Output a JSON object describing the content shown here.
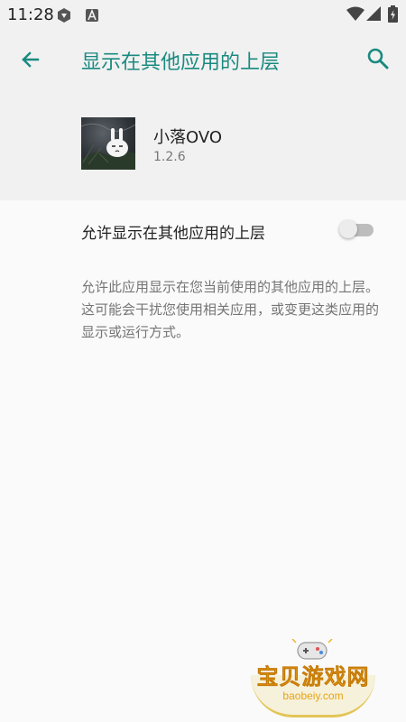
{
  "status_bar": {
    "time": "11:28"
  },
  "app_bar": {
    "title": "显示在其他应用的上层"
  },
  "app": {
    "name": "小落OVO",
    "version": "1.2.6"
  },
  "setting": {
    "label": "允许显示在其他应用的上层",
    "enabled": false
  },
  "description": "允许此应用显示在您当前使用的其他应用的上层。这可能会干扰您使用相关应用，或变更这类应用的显示或运行方式。",
  "watermark": {
    "title": "宝贝游戏网",
    "url": "baobeiy.com"
  },
  "colors": {
    "accent": "#1a8a80",
    "background": "#fafafa",
    "header_background": "#f1f1f1"
  },
  "icons": [
    "back-arrow-icon",
    "search-icon",
    "wifi-icon",
    "cell-signal-icon",
    "battery-icon"
  ]
}
